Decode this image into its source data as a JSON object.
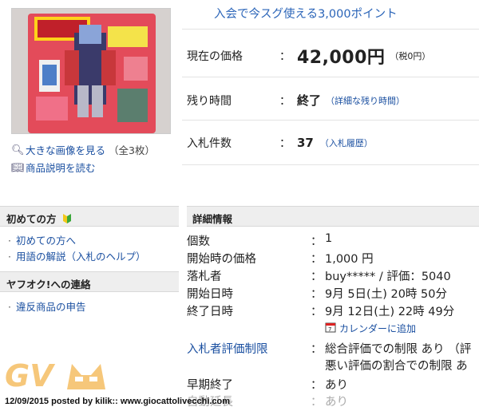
{
  "product": {
    "view_large": "大きな画像を見る",
    "image_count": "（全3枚）",
    "read_description": "商品説明を読む"
  },
  "promo": "入会で今スグ使える3,000ポイント",
  "summary": {
    "price_label": "現在の価格",
    "price_value": "42,000円",
    "tax": "（税0円）",
    "time_label": "残り時間",
    "time_value": "終了",
    "time_link": "（詳細な残り時間）",
    "bids_label": "入札件数",
    "bids_value": "37",
    "bids_link": "（入札履歴）",
    "colon": "："
  },
  "sidebar": {
    "beginner_head": "初めての方",
    "beginner_items": [
      "初めての方へ",
      "用語の解説（入札のヘルプ）"
    ],
    "contact_head": "ヤフオク!への連絡",
    "contact_items": [
      "違反商品の申告"
    ]
  },
  "details": {
    "head": "詳細情報",
    "colon": "：",
    "rows": [
      {
        "label": "個数",
        "value": "1"
      },
      {
        "label": "開始時の価格",
        "value": "1,000 円"
      },
      {
        "label": "落札者",
        "value": "buy***** / 評価：5040"
      },
      {
        "label": "開始日時",
        "value": "9月 5日(土) 20時 50分"
      },
      {
        "label": "終了日時",
        "value": "9月 12日(土) 22時 49分"
      }
    ],
    "calendar_link": "カレンダーに追加",
    "restriction_label": "入札者評価制限",
    "restriction_value1": "総合評価での制限 あり （評",
    "restriction_value2": "悪い評価の割合での制限 あ",
    "early_end_label": "早期終了",
    "early_end_value": "あり",
    "auto_ext_label": "自動延長",
    "auto_ext_value": "あり"
  },
  "watermark": {
    "logo": "GV",
    "caption": "12/09/2015 posted by kilik:: www.giocattolivecchi.com"
  },
  "colors": {
    "link": "#1a4fa0",
    "header_bg": "#eeeeee",
    "beginner_mark": "#3aa83a"
  }
}
